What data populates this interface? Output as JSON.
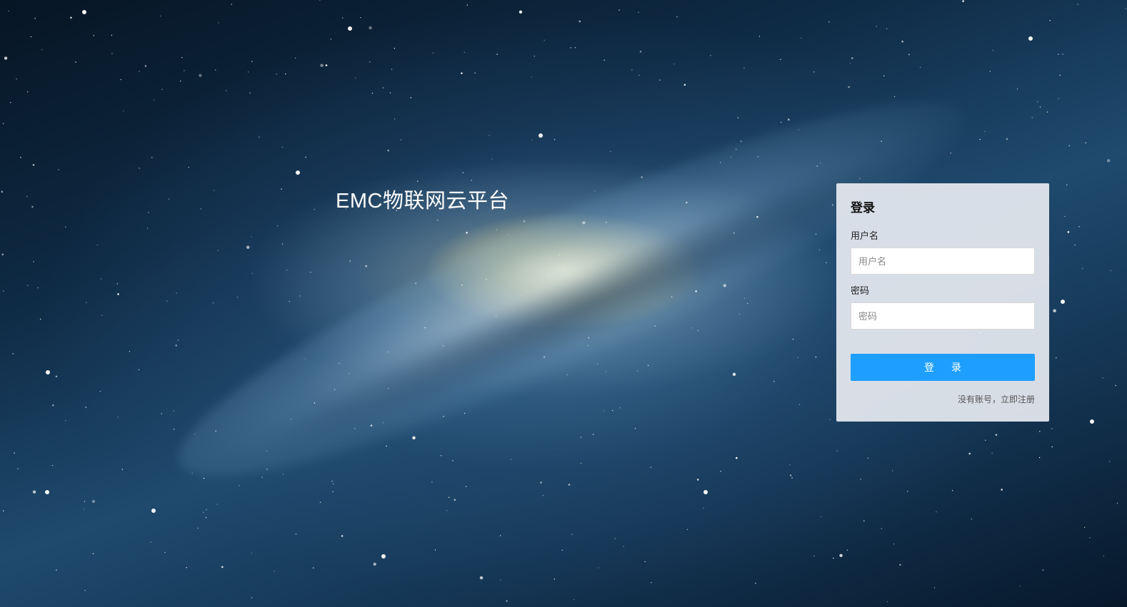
{
  "brand": {
    "title": "EMC物联网云平台"
  },
  "login": {
    "heading": "登录",
    "username": {
      "label": "用户名",
      "placeholder": "用户名",
      "value": ""
    },
    "password": {
      "label": "密码",
      "placeholder": "密码",
      "value": ""
    },
    "submit_label": "登 录",
    "register_link": "没有账号，立即注册"
  },
  "colors": {
    "accent": "#1e9fff",
    "panel_background": "#e6eaf0",
    "title_text": "#ffffff"
  }
}
